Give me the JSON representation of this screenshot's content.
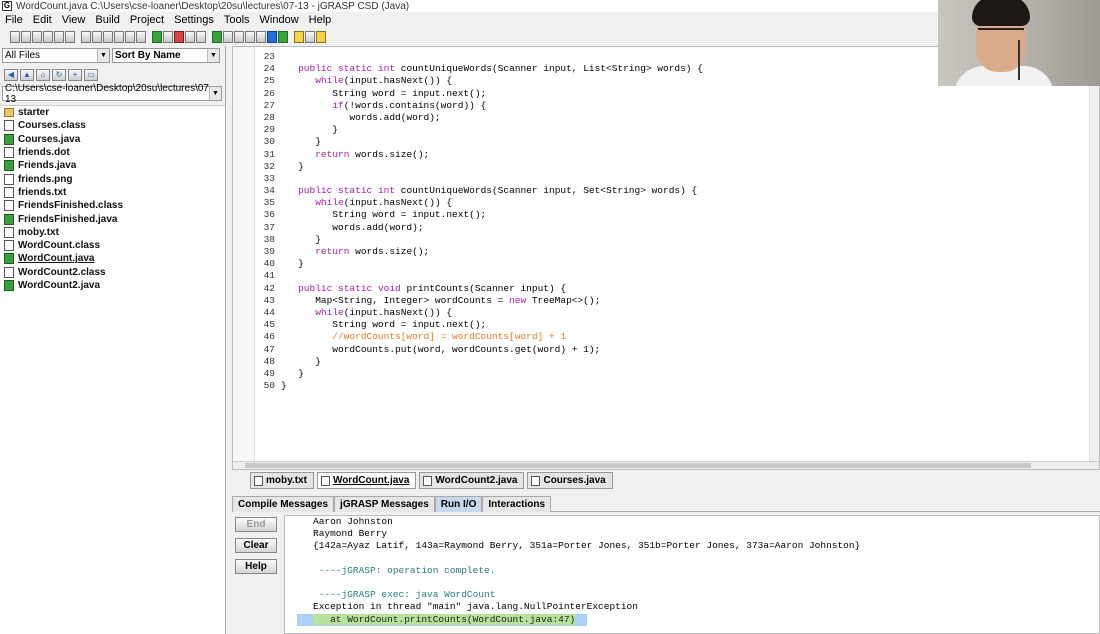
{
  "window": {
    "title": "WordCount.java  C:\\Users\\cse-loaner\\Desktop\\20su\\lectures\\07-13 - jGRASP CSD (Java)"
  },
  "menu": [
    "File",
    "Edit",
    "View",
    "Build",
    "Project",
    "Settings",
    "Tools",
    "Window",
    "Help"
  ],
  "toolbar": {
    "icons": [
      "open-icon",
      "save-icon",
      "print-icon",
      "cut-icon",
      "copy-icon",
      "paste-icon",
      "undo-icon",
      "redo-icon",
      "generate-csd-icon",
      "remove-csd-icon",
      "fold-icon",
      "unfold-icon",
      "compile-icon",
      "run-icon",
      "debug-icon",
      "step-icon",
      "pause-icon",
      "run-green-icon",
      "debug-bug-icon",
      "bar-chart-icon",
      "uml-icon",
      "tree-icon",
      "blue-window-icon",
      "green-window-icon",
      "edit-icon",
      "mail-icon",
      "notes-icon"
    ]
  },
  "sidebar": {
    "filter_value": "All Files",
    "sort_value": "Sort By Name",
    "path_value": "C:\\Users\\cse-loaner\\Desktop\\20su\\lectures\\07-13",
    "files": [
      {
        "name": "starter",
        "type": "folder"
      },
      {
        "name": "Courses.class",
        "type": "class"
      },
      {
        "name": "Courses.java",
        "type": "java"
      },
      {
        "name": "friends.dot",
        "type": "file"
      },
      {
        "name": "Friends.java",
        "type": "java"
      },
      {
        "name": "friends.png",
        "type": "file"
      },
      {
        "name": "friends.txt",
        "type": "file"
      },
      {
        "name": "FriendsFinished.class",
        "type": "class"
      },
      {
        "name": "FriendsFinished.java",
        "type": "java"
      },
      {
        "name": "moby.txt",
        "type": "file"
      },
      {
        "name": "WordCount.class",
        "type": "class"
      },
      {
        "name": "WordCount.java",
        "type": "java",
        "selected": true
      },
      {
        "name": "WordCount2.class",
        "type": "class"
      },
      {
        "name": "WordCount2.java",
        "type": "java"
      }
    ]
  },
  "editor": {
    "lines": [
      {
        "n": "23",
        "text": ""
      },
      {
        "n": "24",
        "text": "   public static int countUniqueWords(Scanner input, List<String> words) {"
      },
      {
        "n": "25",
        "text": "      while(input.hasNext()) {"
      },
      {
        "n": "26",
        "text": "         String word = input.next();"
      },
      {
        "n": "27",
        "text": "         if(!words.contains(word)) {"
      },
      {
        "n": "28",
        "text": "            words.add(word);"
      },
      {
        "n": "29",
        "text": "         }"
      },
      {
        "n": "30",
        "text": "      }"
      },
      {
        "n": "31",
        "text": "      return words.size();"
      },
      {
        "n": "32",
        "text": "   }"
      },
      {
        "n": "33",
        "text": ""
      },
      {
        "n": "34",
        "text": "   public static int countUniqueWords(Scanner input, Set<String> words) {"
      },
      {
        "n": "35",
        "text": "      while(input.hasNext()) {"
      },
      {
        "n": "36",
        "text": "         String word = input.next();"
      },
      {
        "n": "37",
        "text": "         words.add(word);"
      },
      {
        "n": "38",
        "text": "      }"
      },
      {
        "n": "39",
        "text": "      return words.size();"
      },
      {
        "n": "40",
        "text": "   }"
      },
      {
        "n": "41",
        "text": ""
      },
      {
        "n": "42",
        "text": "   public static void printCounts(Scanner input) {"
      },
      {
        "n": "43",
        "text": "      Map<String, Integer> wordCounts = new TreeMap<>();"
      },
      {
        "n": "44",
        "text": "      while(input.hasNext()) {"
      },
      {
        "n": "45",
        "text": "         String word = input.next();"
      },
      {
        "n": "46",
        "text": "         //wordCounts[word] = wordCounts[word] + 1",
        "comment": true
      },
      {
        "n": "47",
        "text": "         wordCounts.put(word, wordCounts.get(word) + 1);"
      },
      {
        "n": "48",
        "text": "      }"
      },
      {
        "n": "49",
        "text": "   }"
      },
      {
        "n": "50",
        "text": "}"
      }
    ]
  },
  "file_tabs": [
    {
      "label": "moby.txt",
      "active": false
    },
    {
      "label": "WordCount.java",
      "active": true
    },
    {
      "label": "WordCount2.java",
      "active": false
    },
    {
      "label": "Courses.java",
      "active": false
    }
  ],
  "message_tabs": [
    {
      "label": "Compile Messages",
      "active": false
    },
    {
      "label": "jGRASP Messages",
      "active": false
    },
    {
      "label": "Run I/O",
      "active": true
    },
    {
      "label": "Interactions",
      "active": false
    }
  ],
  "io_buttons": {
    "end": "End",
    "clear": "Clear",
    "help": "Help"
  },
  "io_output": [
    {
      "text": "Aaron Johnston",
      "kind": "out"
    },
    {
      "text": "Raymond Berry",
      "kind": "out"
    },
    {
      "text": "{142a=Ayaz Latif, 143a=Raymond Berry, 351a=Porter Jones, 351b=Porter Jones, 373a=Aaron Johnston}",
      "kind": "out"
    },
    {
      "text": "",
      "kind": "blank"
    },
    {
      "text": " ----jGRASP: operation complete.",
      "kind": "info"
    },
    {
      "text": "",
      "kind": "blank"
    },
    {
      "text": " ----jGRASP exec: java WordCount",
      "kind": "info"
    },
    {
      "text": "Exception in thread \"main\" java.lang.NullPointerException",
      "kind": "out"
    },
    {
      "text": "   at WordCount.printCounts(WordCount.java:47)",
      "kind": "hl"
    }
  ]
}
